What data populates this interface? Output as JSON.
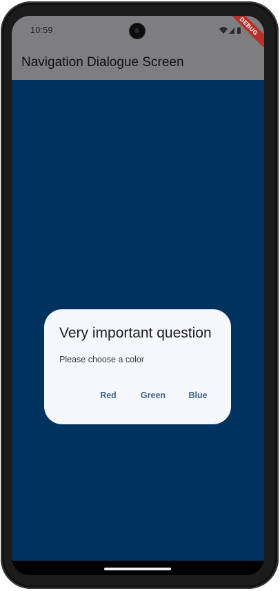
{
  "status_bar": {
    "time": "10:59",
    "icons": [
      "wifi-icon",
      "signal-icon",
      "battery-icon"
    ],
    "debug_label": "DEBUG"
  },
  "app_bar": {
    "title": "Navigation Dialogue Screen"
  },
  "dialog": {
    "title": "Very important question",
    "content": "Please choose a color",
    "actions": [
      "Red",
      "Green",
      "Blue"
    ]
  },
  "colors": {
    "app_bar": "#7e7d80",
    "background": "#003260",
    "dialog_surface": "#f6f7fd",
    "button_text": "#3d5f8f",
    "debug_banner": "#b7312b"
  }
}
